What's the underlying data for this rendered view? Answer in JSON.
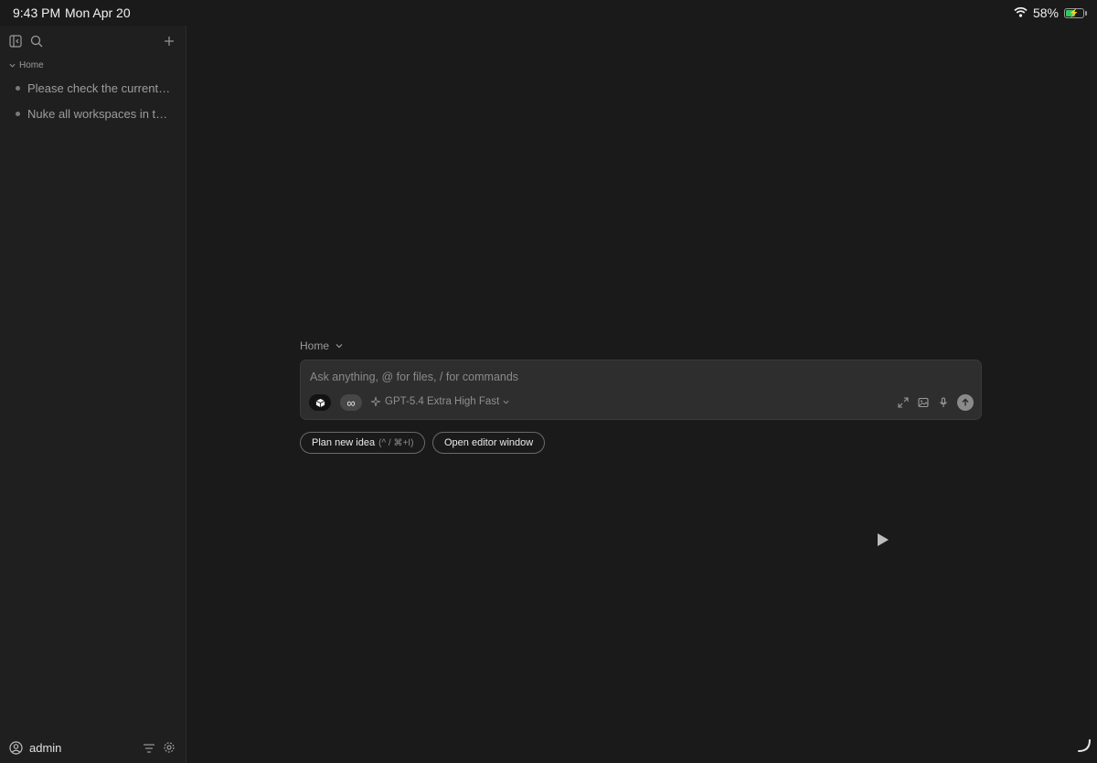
{
  "status_bar": {
    "time": "9:43 PM",
    "date": "Mon Apr 20",
    "battery_percent": "58%",
    "battery_level": 0.58
  },
  "sidebar": {
    "section": "Home",
    "items": [
      {
        "label": "Please check the current ..."
      },
      {
        "label": "Nuke all workspaces in th..."
      }
    ],
    "user": "admin"
  },
  "main": {
    "breadcrumb": "Home",
    "composer": {
      "placeholder": "Ask anything, @ for files, / for commands",
      "model": "GPT-5.4 Extra High Fast"
    },
    "actions": {
      "plan_label": "Plan new idea",
      "plan_hint": "(^ / ⌘+I)",
      "editor_label": "Open editor window"
    }
  },
  "colors": {
    "background": "#1a1a1a",
    "sidebar": "#1f1f1f",
    "composer": "#2e2e2e",
    "battery_charging": "#35c759"
  }
}
